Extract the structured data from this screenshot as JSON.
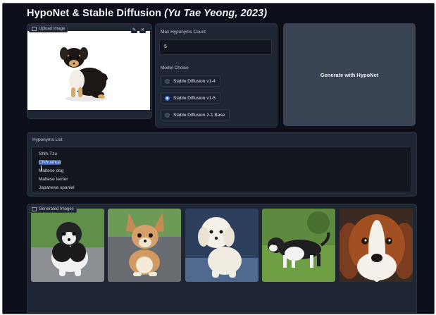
{
  "header": {
    "title": "HypoNet & Stable Diffusion",
    "subtitle": "(Yu Tae Yeong, 2023)"
  },
  "upload": {
    "label": "Upload Image",
    "icons": [
      "edit-icon",
      "close-icon"
    ]
  },
  "count": {
    "label": "Max Hyponyms Count",
    "value": "5"
  },
  "model": {
    "label": "Model Choice",
    "options": [
      "Stable Diffusion v1-4",
      "Stable Diffusion v1-5",
      "Stable Diffusion 2-1 Base"
    ],
    "selected": "Stable Diffusion v1-5"
  },
  "generate": {
    "label": "Generate with HypoNet"
  },
  "hyponyms": {
    "label": "Hyponyms List",
    "items": [
      "Shih-Tzu",
      "Chihuahua",
      "Maltese dog",
      "Maltese terrier",
      "Japanese spaniel"
    ],
    "selection": "Chihuahua"
  },
  "gallery": {
    "label": "Generated Images",
    "count": 5
  },
  "colors": {
    "background": "#0c0f1a",
    "panel": "#1e2533",
    "button": "#3a4353",
    "accent": "#3a78f2"
  }
}
